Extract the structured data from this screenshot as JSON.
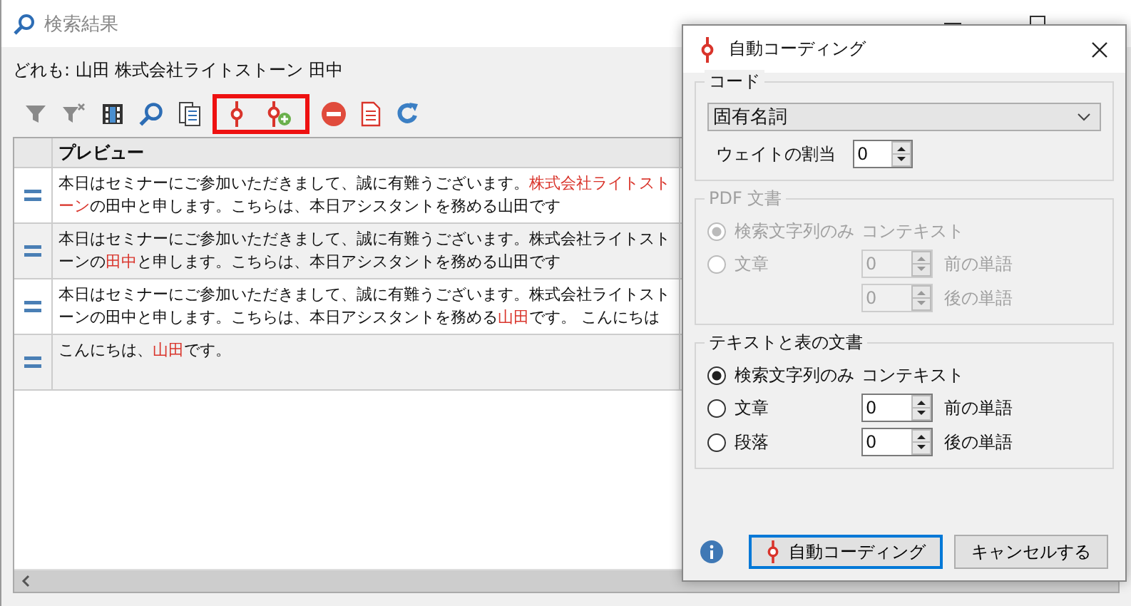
{
  "window": {
    "title": "検索結果"
  },
  "query": "どれも: 山田 株式会社ライトストーン 田中",
  "toolbar": [
    {
      "highlighted": false,
      "items": [
        {
          "kind": "filter",
          "disabled": true
        },
        {
          "kind": "filter-clear",
          "disabled": true
        },
        {
          "kind": "grid"
        },
        {
          "kind": "search"
        },
        {
          "kind": "doc-list"
        }
      ]
    },
    {
      "highlighted": true,
      "items": [
        {
          "kind": "code"
        },
        {
          "kind": "code-add"
        }
      ]
    },
    {
      "highlighted": false,
      "items": [
        {
          "kind": "remove"
        },
        {
          "kind": "red-doc"
        },
        {
          "kind": "refresh"
        }
      ]
    }
  ],
  "table": {
    "columns": [
      "プレビュー"
    ],
    "rows": [
      {
        "segments": [
          {
            "text": "本日はセミナーにご参加いただきまして、誠に有難うございます。",
            "hit": false
          },
          {
            "text": "株式会社ライトストーン",
            "hit": true
          },
          {
            "text": "の田中と申します。こちらは、本日アシスタントを務める山田です",
            "hit": false
          }
        ]
      },
      {
        "segments": [
          {
            "text": "本日はセミナーにご参加いただきまして、誠に有難うございます。株式会社ライトストーンの",
            "hit": false
          },
          {
            "text": "田中",
            "hit": true
          },
          {
            "text": "と申します。こちらは、本日アシスタントを務める山田です",
            "hit": false
          }
        ]
      },
      {
        "segments": [
          {
            "text": "本日はセミナーにご参加いただきまして、誠に有難うございます。株式会社ライトストーンの田中と申します。こちらは、本日アシスタントを務める",
            "hit": false
          },
          {
            "text": "山田",
            "hit": true
          },
          {
            "text": "です。 こんにちは",
            "hit": false
          }
        ]
      },
      {
        "segments": [
          {
            "text": "こんにちは、",
            "hit": false
          },
          {
            "text": "山田",
            "hit": true
          },
          {
            "text": "です。",
            "hit": false
          }
        ]
      }
    ]
  },
  "dialog": {
    "title": "自動コーディング",
    "code_group": {
      "title": "コード",
      "dropdown": "固有名詞",
      "weight_label": "ウェイトの割当",
      "weight": "0"
    },
    "groups": [
      {
        "title": "PDF 文書",
        "disabled": true,
        "context_label": "コンテキスト",
        "options": [
          {
            "label": "検索文字列のみ",
            "selected": true
          },
          {
            "label": "文章",
            "selected": false
          }
        ],
        "before": {
          "value": "0",
          "label": "前の単語"
        },
        "after": {
          "value": "0",
          "label": "後の単語"
        }
      },
      {
        "title": "テキストと表の文書",
        "disabled": false,
        "context_label": "コンテキスト",
        "options": [
          {
            "label": "検索文字列のみ",
            "selected": true
          },
          {
            "label": "文章",
            "selected": false
          },
          {
            "label": "段落",
            "selected": false
          }
        ],
        "before": {
          "value": "0",
          "label": "前の単語"
        },
        "after": {
          "value": "0",
          "label": "後の単語"
        }
      }
    ],
    "buttons": [
      {
        "label": "自動コーディング",
        "default": true
      },
      {
        "label": "キャンセルする",
        "default": false
      }
    ]
  }
}
